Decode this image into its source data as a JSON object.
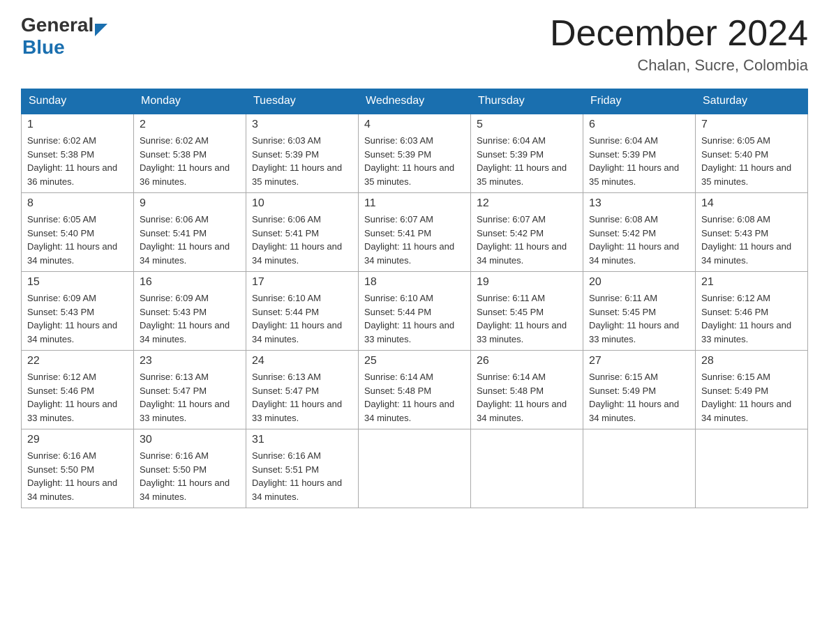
{
  "header": {
    "logo_general": "General",
    "logo_blue": "Blue",
    "month_title": "December 2024",
    "location": "Chalan, Sucre, Colombia"
  },
  "days_of_week": [
    "Sunday",
    "Monday",
    "Tuesday",
    "Wednesday",
    "Thursday",
    "Friday",
    "Saturday"
  ],
  "weeks": [
    [
      {
        "day": "1",
        "sunrise": "6:02 AM",
        "sunset": "5:38 PM",
        "daylight": "11 hours and 36 minutes."
      },
      {
        "day": "2",
        "sunrise": "6:02 AM",
        "sunset": "5:38 PM",
        "daylight": "11 hours and 36 minutes."
      },
      {
        "day": "3",
        "sunrise": "6:03 AM",
        "sunset": "5:39 PM",
        "daylight": "11 hours and 35 minutes."
      },
      {
        "day": "4",
        "sunrise": "6:03 AM",
        "sunset": "5:39 PM",
        "daylight": "11 hours and 35 minutes."
      },
      {
        "day": "5",
        "sunrise": "6:04 AM",
        "sunset": "5:39 PM",
        "daylight": "11 hours and 35 minutes."
      },
      {
        "day": "6",
        "sunrise": "6:04 AM",
        "sunset": "5:39 PM",
        "daylight": "11 hours and 35 minutes."
      },
      {
        "day": "7",
        "sunrise": "6:05 AM",
        "sunset": "5:40 PM",
        "daylight": "11 hours and 35 minutes."
      }
    ],
    [
      {
        "day": "8",
        "sunrise": "6:05 AM",
        "sunset": "5:40 PM",
        "daylight": "11 hours and 34 minutes."
      },
      {
        "day": "9",
        "sunrise": "6:06 AM",
        "sunset": "5:41 PM",
        "daylight": "11 hours and 34 minutes."
      },
      {
        "day": "10",
        "sunrise": "6:06 AM",
        "sunset": "5:41 PM",
        "daylight": "11 hours and 34 minutes."
      },
      {
        "day": "11",
        "sunrise": "6:07 AM",
        "sunset": "5:41 PM",
        "daylight": "11 hours and 34 minutes."
      },
      {
        "day": "12",
        "sunrise": "6:07 AM",
        "sunset": "5:42 PM",
        "daylight": "11 hours and 34 minutes."
      },
      {
        "day": "13",
        "sunrise": "6:08 AM",
        "sunset": "5:42 PM",
        "daylight": "11 hours and 34 minutes."
      },
      {
        "day": "14",
        "sunrise": "6:08 AM",
        "sunset": "5:43 PM",
        "daylight": "11 hours and 34 minutes."
      }
    ],
    [
      {
        "day": "15",
        "sunrise": "6:09 AM",
        "sunset": "5:43 PM",
        "daylight": "11 hours and 34 minutes."
      },
      {
        "day": "16",
        "sunrise": "6:09 AM",
        "sunset": "5:43 PM",
        "daylight": "11 hours and 34 minutes."
      },
      {
        "day": "17",
        "sunrise": "6:10 AM",
        "sunset": "5:44 PM",
        "daylight": "11 hours and 34 minutes."
      },
      {
        "day": "18",
        "sunrise": "6:10 AM",
        "sunset": "5:44 PM",
        "daylight": "11 hours and 33 minutes."
      },
      {
        "day": "19",
        "sunrise": "6:11 AM",
        "sunset": "5:45 PM",
        "daylight": "11 hours and 33 minutes."
      },
      {
        "day": "20",
        "sunrise": "6:11 AM",
        "sunset": "5:45 PM",
        "daylight": "11 hours and 33 minutes."
      },
      {
        "day": "21",
        "sunrise": "6:12 AM",
        "sunset": "5:46 PM",
        "daylight": "11 hours and 33 minutes."
      }
    ],
    [
      {
        "day": "22",
        "sunrise": "6:12 AM",
        "sunset": "5:46 PM",
        "daylight": "11 hours and 33 minutes."
      },
      {
        "day": "23",
        "sunrise": "6:13 AM",
        "sunset": "5:47 PM",
        "daylight": "11 hours and 33 minutes."
      },
      {
        "day": "24",
        "sunrise": "6:13 AM",
        "sunset": "5:47 PM",
        "daylight": "11 hours and 33 minutes."
      },
      {
        "day": "25",
        "sunrise": "6:14 AM",
        "sunset": "5:48 PM",
        "daylight": "11 hours and 34 minutes."
      },
      {
        "day": "26",
        "sunrise": "6:14 AM",
        "sunset": "5:48 PM",
        "daylight": "11 hours and 34 minutes."
      },
      {
        "day": "27",
        "sunrise": "6:15 AM",
        "sunset": "5:49 PM",
        "daylight": "11 hours and 34 minutes."
      },
      {
        "day": "28",
        "sunrise": "6:15 AM",
        "sunset": "5:49 PM",
        "daylight": "11 hours and 34 minutes."
      }
    ],
    [
      {
        "day": "29",
        "sunrise": "6:16 AM",
        "sunset": "5:50 PM",
        "daylight": "11 hours and 34 minutes."
      },
      {
        "day": "30",
        "sunrise": "6:16 AM",
        "sunset": "5:50 PM",
        "daylight": "11 hours and 34 minutes."
      },
      {
        "day": "31",
        "sunrise": "6:16 AM",
        "sunset": "5:51 PM",
        "daylight": "11 hours and 34 minutes."
      },
      null,
      null,
      null,
      null
    ]
  ]
}
